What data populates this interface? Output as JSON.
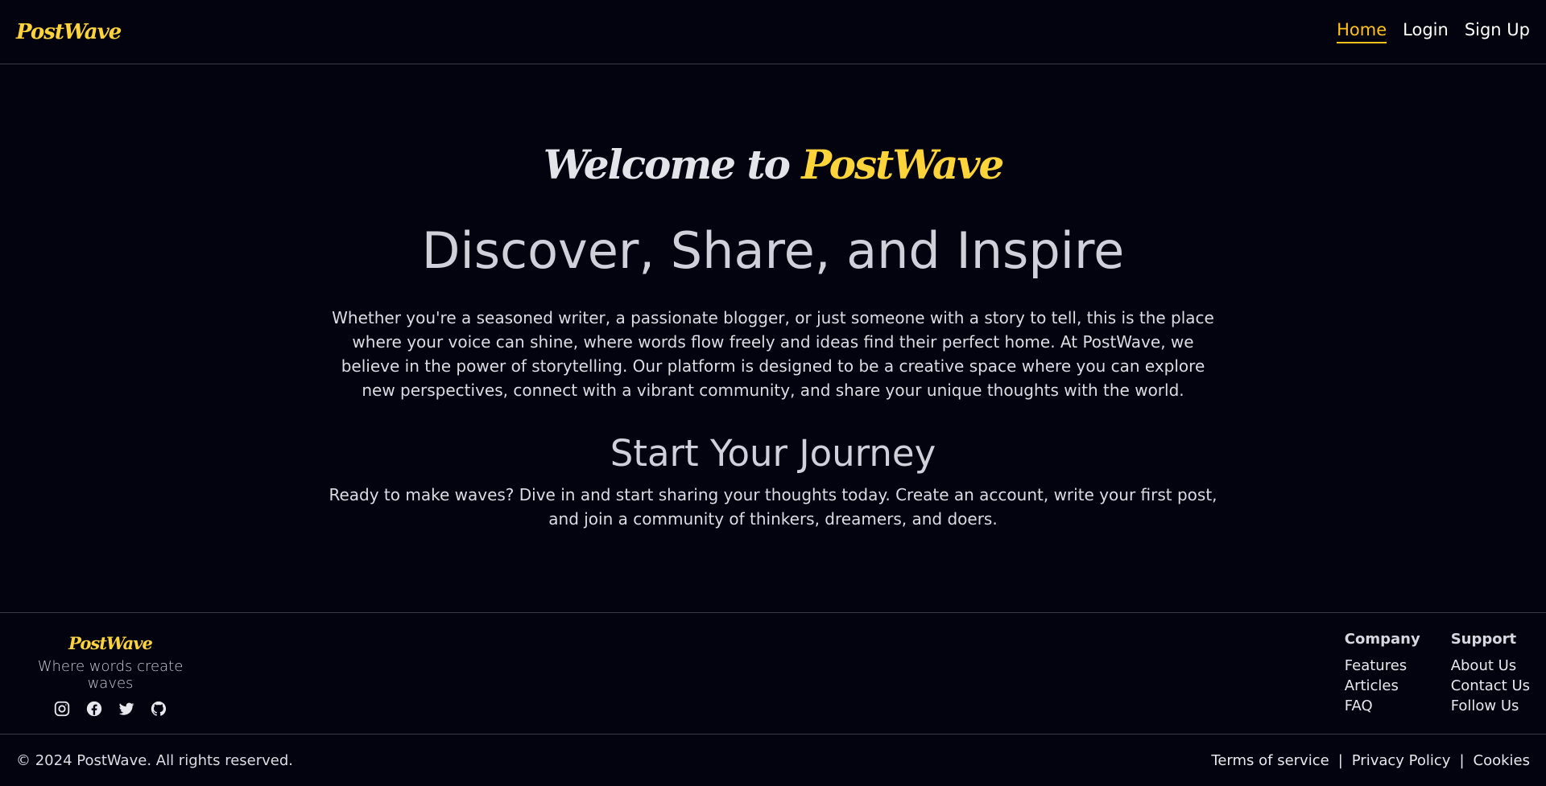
{
  "nav": {
    "logo": "PostWave",
    "links": [
      {
        "label": "Home",
        "active": true
      },
      {
        "label": "Login",
        "active": false
      },
      {
        "label": "Sign Up",
        "active": false
      }
    ]
  },
  "hero": {
    "welcome_prefix": "Welcome to",
    "welcome_brand": "PostWave",
    "headline": "Discover, Share, and Inspire",
    "intro": "Whether you're a seasoned writer, a passionate blogger, or just someone with a story to tell, this is the place where your voice can shine, where words flow freely and ideas find their perfect home. At PostWave, we believe in the power of storytelling. Our platform is designed to be a creative space where you can explore new perspectives, connect with a vibrant community, and share your unique thoughts with the world.",
    "journey_title": "Start Your Journey",
    "journey_text": "Ready to make waves? Dive in and start sharing your thoughts today. Create an account, write your first post, and join a community of thinkers, dreamers, and doers."
  },
  "footer": {
    "logo": "PostWave",
    "tagline": "Where words create waves",
    "social_icons": [
      "instagram-icon",
      "facebook-icon",
      "twitter-icon",
      "github-icon"
    ],
    "columns": [
      {
        "title": "Company",
        "links": [
          "Features",
          "Articles",
          "FAQ"
        ]
      },
      {
        "title": "Support",
        "links": [
          "About Us",
          "Contact Us",
          "Follow Us"
        ]
      }
    ],
    "copyright": "© 2024 PostWave. All rights reserved.",
    "legal": [
      "Terms of service",
      "Privacy Policy",
      "Cookies"
    ],
    "separator": "|"
  },
  "colors": {
    "background": "#03030f",
    "accent": "#ffd43b",
    "active_link": "#ffc21a"
  }
}
